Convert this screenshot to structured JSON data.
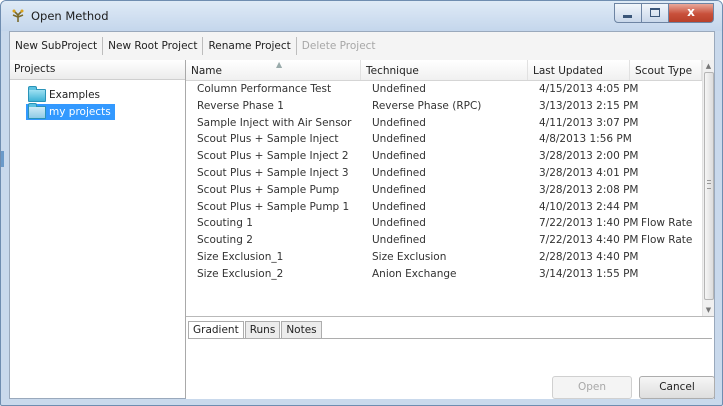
{
  "window": {
    "title": "Open Method",
    "close_glyph": "x"
  },
  "toolbar": {
    "items": [
      {
        "label": "New SubProject",
        "enabled": true
      },
      {
        "label": "New Root Project",
        "enabled": true
      },
      {
        "label": "Rename Project",
        "enabled": true
      },
      {
        "label": "Delete Project",
        "enabled": false
      }
    ]
  },
  "projects": {
    "header": "Projects",
    "items": [
      {
        "label": "Examples",
        "icon": "folder-icon",
        "selected": false
      },
      {
        "label": "my projects",
        "icon": "folder-icon",
        "selected": true
      }
    ]
  },
  "table": {
    "columns": [
      "Name",
      "Technique",
      "Last Updated",
      "Scout Type"
    ],
    "rows": [
      [
        "Column Performance Test",
        "Undefined",
        "4/15/2013 4:05 PM",
        ""
      ],
      [
        "Reverse Phase 1",
        "Reverse Phase (RPC)",
        "3/13/2013 2:15 PM",
        ""
      ],
      [
        "Sample Inject with Air Sensor",
        "Undefined",
        "4/11/2013 3:07 PM",
        ""
      ],
      [
        "Scout Plus + Sample Inject",
        "Undefined",
        "4/8/2013 1:56 PM",
        ""
      ],
      [
        "Scout Plus + Sample Inject 2",
        "Undefined",
        "3/28/2013 2:00 PM",
        ""
      ],
      [
        "Scout Plus + Sample Inject 3",
        "Undefined",
        "3/28/2013 4:01 PM",
        ""
      ],
      [
        "Scout Plus + Sample Pump",
        "Undefined",
        "3/28/2013 2:08 PM",
        ""
      ],
      [
        "Scout Plus + Sample Pump 1",
        "Undefined",
        "4/10/2013 2:44 PM",
        ""
      ],
      [
        "Scouting 1",
        "Undefined",
        "7/22/2013 1:40 PM",
        "Flow Rate"
      ],
      [
        "Scouting 2",
        "Undefined",
        "7/22/2013 4:40 PM",
        "Flow Rate"
      ],
      [
        "Size Exclusion_1",
        "Size Exclusion",
        "2/28/2013 4:40 PM",
        ""
      ],
      [
        "Size Exclusion_2",
        "Anion Exchange",
        "3/14/2013 1:55 PM",
        ""
      ]
    ]
  },
  "tabs": {
    "items": [
      "Gradient",
      "Runs",
      "Notes"
    ],
    "active": "Gradient"
  },
  "buttons": {
    "open": "Open",
    "cancel": "Cancel"
  },
  "colors": {
    "selection": "#3399ff",
    "disabled_text": "#a7a7a7"
  }
}
